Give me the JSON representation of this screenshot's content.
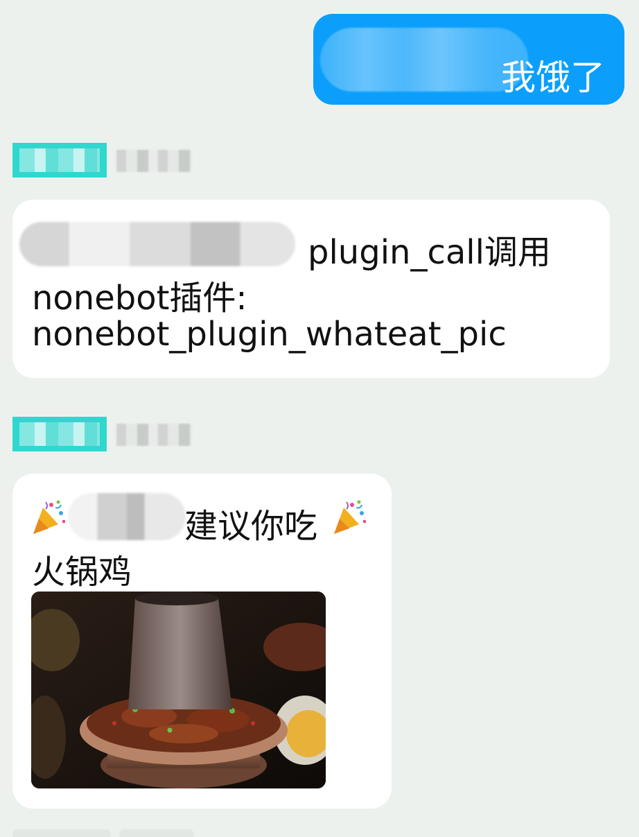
{
  "outgoing": {
    "text": "我饿了"
  },
  "messages": [
    {
      "lines": [
        "plugin_call调用",
        "nonebot插件:",
        "nonebot_plugin_whateat_pic"
      ]
    },
    {
      "lines": [
        "建议你吃",
        "火锅鸡"
      ],
      "emoji": "party-popper-icon",
      "image": "hotpot-chicken-photo"
    }
  ],
  "colors": {
    "background": "#edf1ee",
    "outgoing_bubble": "#0b9ffb",
    "incoming_bubble": "#ffffff",
    "name_highlight": "#2fd7cf"
  }
}
